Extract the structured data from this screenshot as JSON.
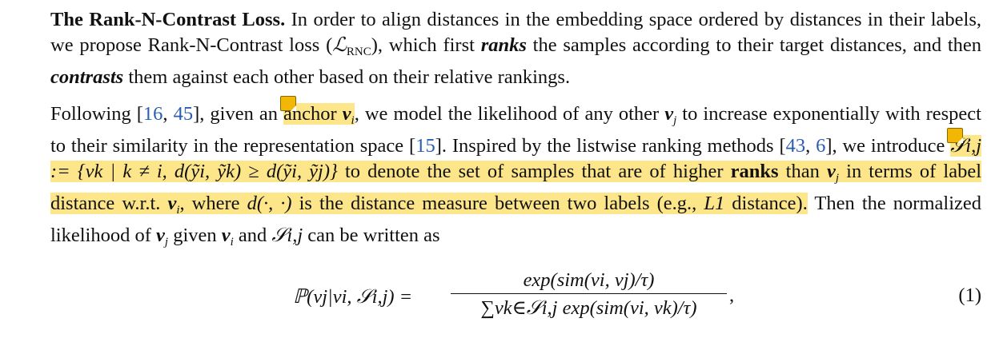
{
  "paragraph1": {
    "heading": "The Rank-N-Contrast Loss.",
    "text_a": " In order to align distances in the embedding space ordered by distances in their labels, we propose Rank-N-Contrast loss (",
    "loss_symbol": "ℒ",
    "loss_subscript": "RNC",
    "text_b": "), which first ",
    "ranks": "ranks",
    "text_c": " the samples according to their target distances, and then ",
    "contrasts": "contrasts",
    "text_d": " them against each other based on their relative rankings."
  },
  "paragraph2": {
    "text_a": "Following [",
    "cite_16": "16",
    "sep_1": ", ",
    "cite_45": "45",
    "text_b": "], given an ",
    "anchor_word": "anchor ",
    "v": "v",
    "i": "i",
    "j": "j",
    "text_c": ", we model the likelihood of any other ",
    "text_d": " to increase exponentially with respect to their similarity in the representation space [",
    "cite_15": "15",
    "text_e": "]. Inspired by the listwise ranking methods [",
    "cite_43": "43",
    "sep_2": ", ",
    "cite_6": "6",
    "text_f": "], we introduce ",
    "set_def": "𝒮i,j := {vk | k ≠ i, d(ỹi, ỹk) ≥ d(ỹi, ỹj)}",
    "text_g": " to denote the set of samples that are of higher ",
    "ranks_bold": "ranks",
    "text_h": " than ",
    "text_i": " in terms of label distance w.r.t. ",
    "text_j": ", where ",
    "d_expr": "d(·, ·)",
    "text_k": " is the distance measure between two labels (e.g., ",
    "L1": "L1",
    "text_l": " distance).",
    "text_m": " Then the normalized likelihood of ",
    "text_n": " given ",
    "text_o": " and ",
    "S_ij": "𝒮i,j",
    "text_p": " can be written as"
  },
  "equation": {
    "lhs": "ℙ(vj|vi, 𝒮i,j) =",
    "numerator": "exp(sim(vi, vj)/τ)",
    "denominator": "∑vk∈𝒮i,j exp(sim(vi, vk)/τ)",
    "trailing": ",",
    "number": "(1)"
  },
  "annotations": [
    {
      "name": "sticky-note-icon",
      "color": "#f2b705"
    },
    {
      "name": "sticky-note-icon",
      "color": "#f2b705"
    }
  ],
  "colors": {
    "highlight": "#fde68a",
    "citation": "#2a5db0"
  }
}
